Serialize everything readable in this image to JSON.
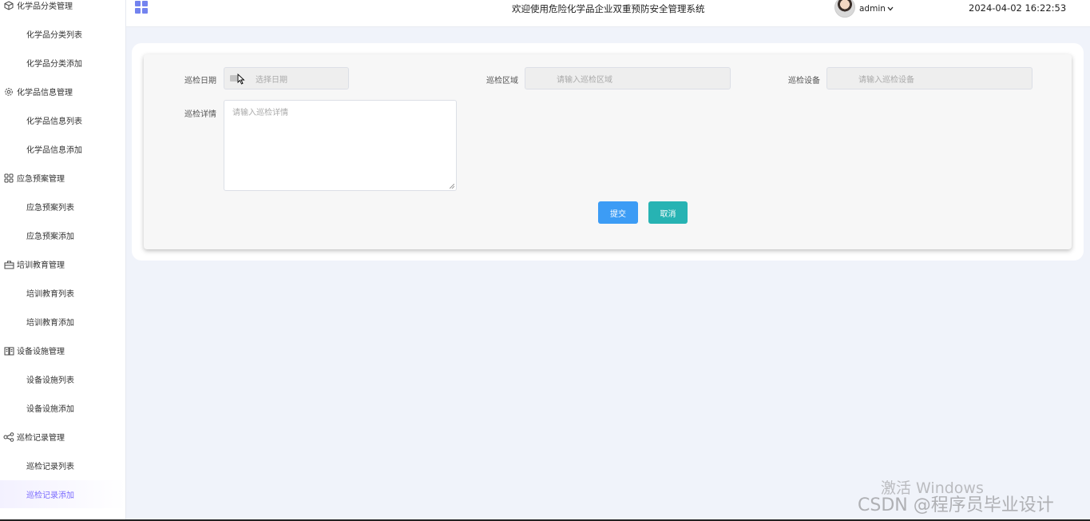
{
  "header": {
    "title": "欢迎使用危险化学品企业双重预防安全管理系统",
    "username": "admin",
    "datetime": "2024-04-02 16:22:53"
  },
  "sidebar": {
    "groups": [
      {
        "label": "化学品分类管理",
        "icon": "box-icon",
        "items": [
          "化学品分类列表",
          "化学品分类添加"
        ]
      },
      {
        "label": "化学品信息管理",
        "icon": "gear-icon",
        "items": [
          "化学品信息列表",
          "化学品信息添加"
        ]
      },
      {
        "label": "应急预案管理",
        "icon": "grid-icon",
        "items": [
          "应急预案列表",
          "应急预案添加"
        ]
      },
      {
        "label": "培训教育管理",
        "icon": "briefcase-icon",
        "items": [
          "培训教育列表",
          "培训教育添加"
        ]
      },
      {
        "label": "设备设施管理",
        "icon": "book-icon",
        "items": [
          "设备设施列表",
          "设备设施添加"
        ]
      },
      {
        "label": "巡检记录管理",
        "icon": "share-icon",
        "items": [
          "巡检记录列表",
          "巡检记录添加"
        ]
      }
    ],
    "active_item": "巡检记录添加"
  },
  "form": {
    "date_label": "巡检日期",
    "date_placeholder": "选择日期",
    "area_label": "巡检区域",
    "area_placeholder": "请输入巡检区域",
    "device_label": "巡检设备",
    "device_placeholder": "请输入巡检设备",
    "detail_label": "巡检详情",
    "detail_placeholder": "请输入巡检详情",
    "submit_label": "提交",
    "cancel_label": "取消"
  },
  "watermark": {
    "activate": "激活 Windows",
    "csdn": "CSDN @程序员毕业设计"
  },
  "colors": {
    "accent": "#7383ef",
    "active_menu": "#7b6cff",
    "submit": "#3c9cf5",
    "cancel": "#27b3b3",
    "page_bg": "#f0f3fa"
  }
}
